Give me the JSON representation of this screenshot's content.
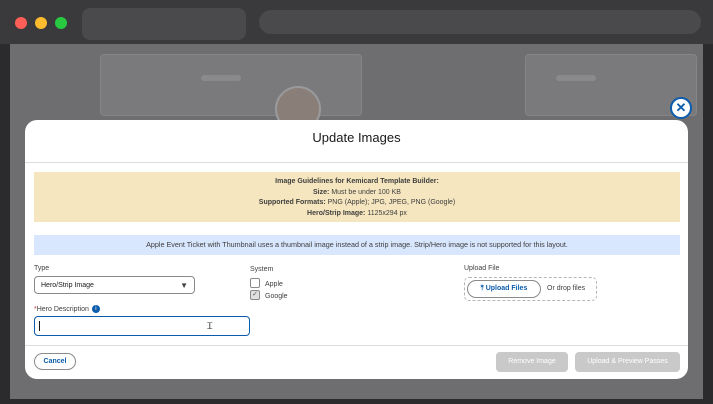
{
  "modal": {
    "title": "Update Images",
    "close_icon": "close-icon",
    "guidelines": {
      "heading": "Image Guidelines for Kemicard Template Builder:",
      "size_label": "Size:",
      "size_value": "Must be under 100 KB",
      "formats_label": "Supported Formats:",
      "formats_value": "PNG (Apple); JPG, JPEG, PNG (Google)",
      "hero_label": "Hero/Strip Image:",
      "hero_value": "1125x294 px",
      "background_color": "#f5e6c0"
    },
    "info_message": "Apple Event Ticket with Thumbnail uses a thumbnail image instead of a strip image. Strip/Hero image is not supported for this layout.",
    "type": {
      "label": "Type",
      "selected": "Hero/Strip Image"
    },
    "hero_description": {
      "required_mark": "*",
      "label": "Hero Description",
      "info_icon": "info-icon",
      "value": ""
    },
    "system": {
      "label": "System",
      "options": [
        {
          "label": "Apple",
          "checked": false
        },
        {
          "label": "Google",
          "checked": true
        }
      ]
    },
    "upload": {
      "label": "Upload File",
      "button_label": "Upload Files",
      "button_icon": "upload-icon",
      "drop_text": "Or drop files"
    },
    "footer": {
      "cancel_label": "Cancel",
      "remove_label": "Remove Image",
      "upload_preview_label": "Upload & Preview Passes"
    }
  },
  "colors": {
    "accent": "#0b5cab",
    "info_bar": "#d8e6fe",
    "disabled_button": "#c9c9c9"
  }
}
